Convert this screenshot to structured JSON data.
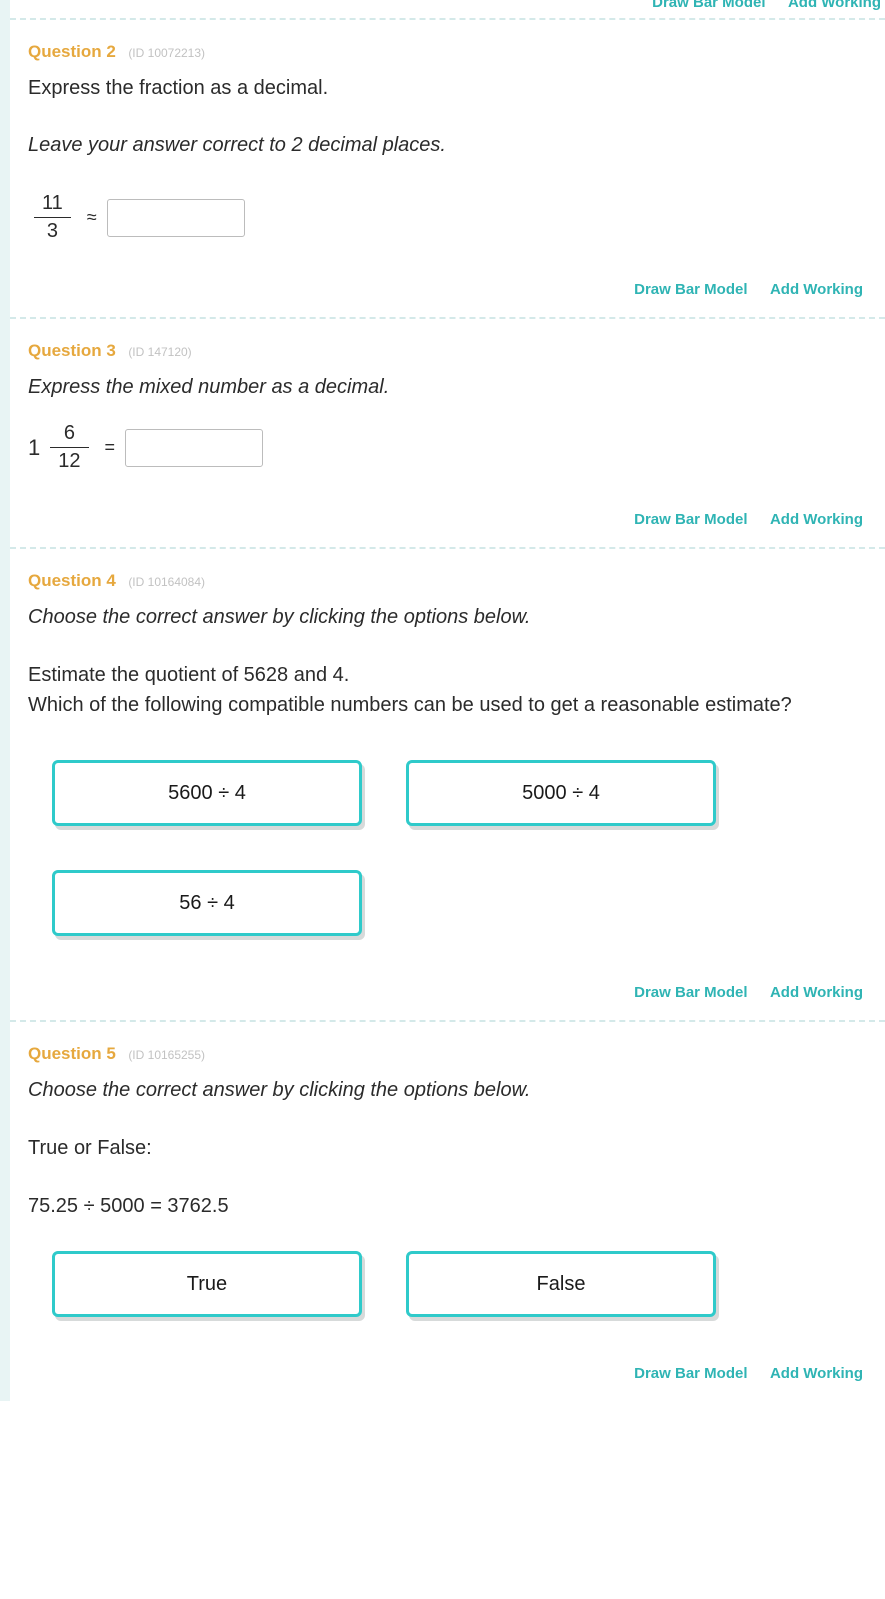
{
  "actions": {
    "draw_bar": "Draw Bar Model",
    "add_working": "Add Working"
  },
  "q2": {
    "title": "Question 2",
    "id": "(ID 10072213)",
    "prompt": "Express the fraction as a decimal.",
    "sub": "Leave your answer correct to 2 decimal places.",
    "num": "11",
    "den": "3",
    "op": "≈"
  },
  "q3": {
    "title": "Question 3",
    "id": "(ID 147120)",
    "prompt": "Express the mixed number as a decimal.",
    "whole": "1",
    "num": "6",
    "den": "12",
    "op": "="
  },
  "q4": {
    "title": "Question 4",
    "id": "(ID 10164084)",
    "prompt": "Choose the correct answer by clicking the options below.",
    "body1": "Estimate the quotient of 5628 and 4.",
    "body2": "Which of the following compatible numbers can be used to get a reasonable estimate?",
    "options": [
      "5600 ÷ 4",
      "5000 ÷ 4",
      "56 ÷ 4"
    ]
  },
  "q5": {
    "title": "Question 5",
    "id": "(ID 10165255)",
    "prompt": "Choose the correct answer by clicking the options below.",
    "body1": "True or False:",
    "body2": "75.25 ÷ 5000 = 3762.5",
    "options": [
      "True",
      "False"
    ]
  }
}
